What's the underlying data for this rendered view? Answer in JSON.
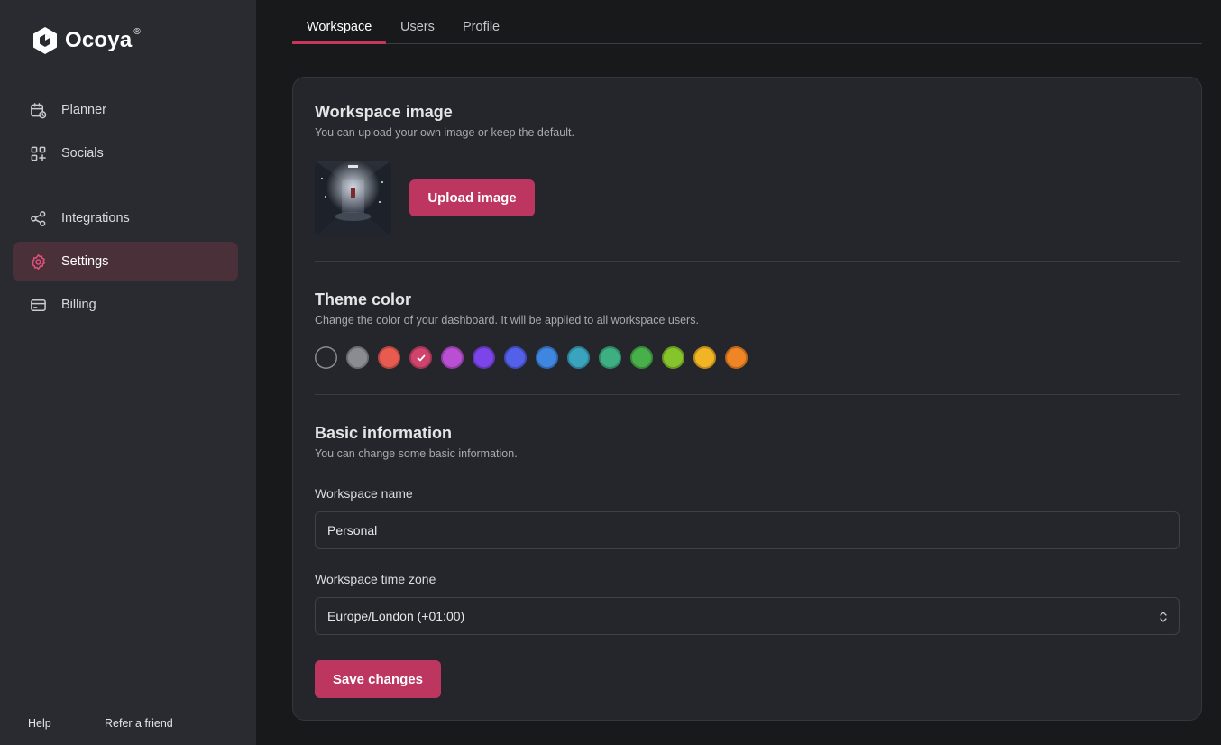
{
  "brand": {
    "name": "Ocoya",
    "registered": "®"
  },
  "sidebar": {
    "items": [
      {
        "label": "Planner",
        "icon": "calendar-clock-icon"
      },
      {
        "label": "Socials",
        "icon": "grid-plus-icon"
      },
      {
        "label": "Integrations",
        "icon": "share-nodes-icon"
      },
      {
        "label": "Settings",
        "icon": "gear-icon",
        "active": true
      },
      {
        "label": "Billing",
        "icon": "credit-card-icon"
      }
    ],
    "footer": {
      "help": "Help",
      "refer": "Refer a friend"
    }
  },
  "tabs": [
    {
      "label": "Workspace",
      "active": true
    },
    {
      "label": "Users"
    },
    {
      "label": "Profile"
    }
  ],
  "workspace_image": {
    "title": "Workspace image",
    "subtitle": "You can upload your own image or keep the default.",
    "upload_label": "Upload image"
  },
  "theme": {
    "title": "Theme color",
    "subtitle": "Change the color of your dashboard. It will be applied to all workspace users.",
    "colors": [
      "#25262b",
      "#8a8c92",
      "#e85b50",
      "#d0436c",
      "#b94fd2",
      "#7b45ea",
      "#5361ea",
      "#3e86e0",
      "#3aa3bd",
      "#3daf82",
      "#48b04a",
      "#86c42c",
      "#f1b424",
      "#ef8524"
    ],
    "selected_index": 3
  },
  "basic": {
    "title": "Basic information",
    "subtitle": "You can change some basic information.",
    "name_label": "Workspace name",
    "name_value": "Personal",
    "tz_label": "Workspace time zone",
    "tz_value": "Europe/London (+01:00)",
    "save_label": "Save changes"
  },
  "colors": {
    "accent": "#bc3660",
    "sidebar_bg": "#2a2b31",
    "card_bg": "#25262b",
    "page_bg": "#18191b"
  }
}
